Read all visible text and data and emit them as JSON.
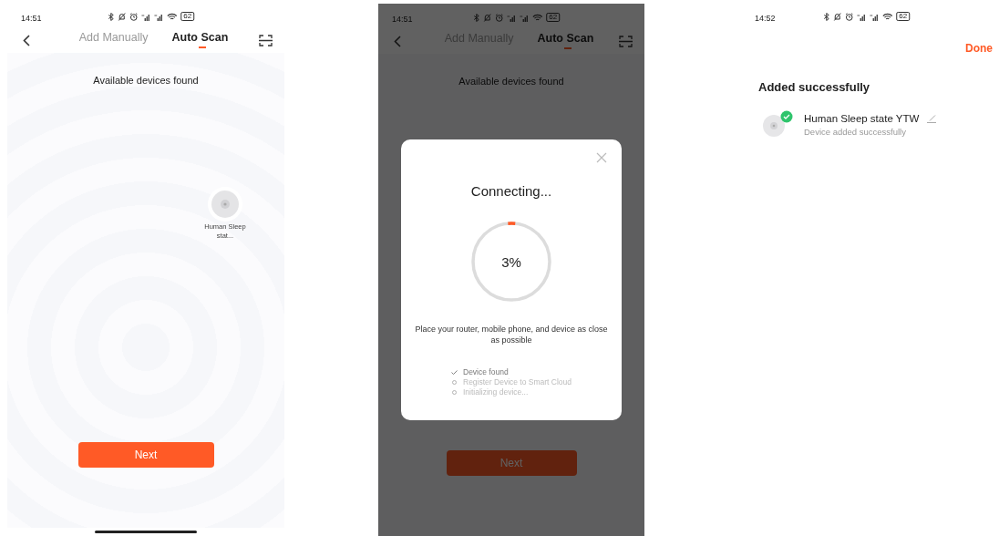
{
  "screens": [
    {
      "kind": "scan",
      "dimmed": false,
      "status": {
        "time": "14:51",
        "battery": "62"
      },
      "tabs": [
        {
          "label": "Add Manually",
          "selected": false
        },
        {
          "label": "Auto Scan",
          "selected": true
        }
      ],
      "heading": "Available devices found",
      "devices": [
        {
          "name": "Human Sleep stat..."
        }
      ],
      "button": "Next"
    },
    {
      "kind": "scan",
      "dimmed": true,
      "status": {
        "time": "14:51",
        "battery": "62"
      },
      "tabs": [
        {
          "label": "Add Manually",
          "selected": false
        },
        {
          "label": "Auto Scan",
          "selected": true
        }
      ],
      "heading": "Available devices found",
      "button": "Next",
      "dialog": {
        "title": "Connecting...",
        "progress": {
          "level": 0.03,
          "reading": "3%"
        },
        "message": "Place your router, mobile phone, and device as close as possible",
        "steps": [
          {
            "label": "Device found",
            "done": true
          },
          {
            "label": "Register Device to Smart Cloud",
            "done": false
          },
          {
            "label": "Initializing device...",
            "done": false
          }
        ]
      }
    },
    {
      "kind": "result",
      "dimmed": false,
      "status": {
        "time": "14:52",
        "battery": "62"
      },
      "action": "Done",
      "heading": "Added successfully",
      "devices": [
        {
          "name": "Human Sleep state YTW",
          "status": "Device added successfully"
        }
      ]
    }
  ]
}
